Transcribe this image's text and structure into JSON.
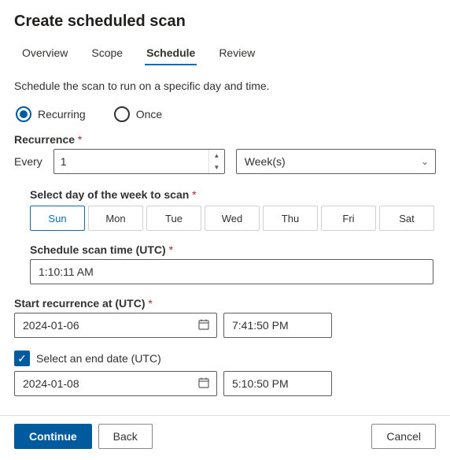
{
  "title": "Create scheduled scan",
  "tabs": [
    "Overview",
    "Scope",
    "Schedule",
    "Review"
  ],
  "active_tab": 2,
  "description": "Schedule the scan to run on a specific day and time.",
  "radios": {
    "recurring": "Recurring",
    "once": "Once",
    "selected": "recurring"
  },
  "recurrence": {
    "label": "Recurrence",
    "every_label": "Every",
    "every_value": "1",
    "unit": "Week(s)"
  },
  "days": {
    "label": "Select day of the week to scan",
    "items": [
      "Sun",
      "Mon",
      "Tue",
      "Wed",
      "Thu",
      "Fri",
      "Sat"
    ],
    "selected": 0
  },
  "schedule_time": {
    "label": "Schedule scan time (UTC)",
    "value": "1:10:11 AM"
  },
  "start": {
    "label": "Start recurrence at (UTC)",
    "date": "2024-01-06",
    "time": "7:41:50 PM"
  },
  "end": {
    "checkbox_label": "Select an end date (UTC)",
    "checked": true,
    "date": "2024-01-08",
    "time": "5:10:50 PM"
  },
  "buttons": {
    "continue": "Continue",
    "back": "Back",
    "cancel": "Cancel"
  }
}
